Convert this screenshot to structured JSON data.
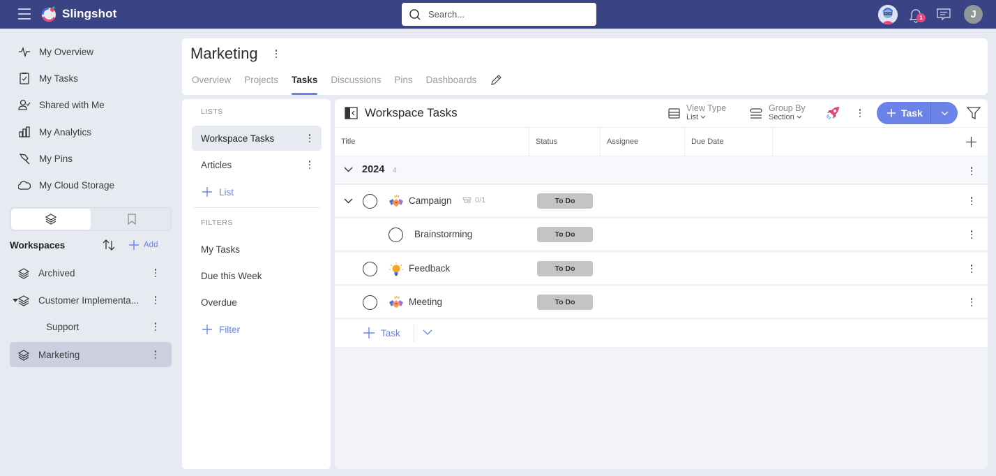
{
  "app": {
    "name": "Slingshot"
  },
  "search": {
    "placeholder": "Search..."
  },
  "topbar": {
    "notification_count": "1",
    "user_initial": "J"
  },
  "nav": {
    "items": [
      {
        "label": "My Overview",
        "icon": "activity-icon"
      },
      {
        "label": "My Tasks",
        "icon": "clipboard-check-icon"
      },
      {
        "label": "Shared with Me",
        "icon": "user-check-icon"
      },
      {
        "label": "My Analytics",
        "icon": "bar-chart-icon"
      },
      {
        "label": "My Pins",
        "icon": "pin-icon"
      },
      {
        "label": "My Cloud Storage",
        "icon": "cloud-icon"
      }
    ],
    "workspaces_label": "Workspaces",
    "add_label": "Add",
    "workspaces": [
      {
        "label": "Archived"
      },
      {
        "label": "Customer Implementa..."
      },
      {
        "label": "Support"
      },
      {
        "label": "Marketing",
        "selected": true
      }
    ]
  },
  "header": {
    "title": "Marketing",
    "tabs": [
      "Overview",
      "Projects",
      "Tasks",
      "Discussions",
      "Pins",
      "Dashboards"
    ],
    "active_tab": "Tasks"
  },
  "lists": {
    "lists_label": "LISTS",
    "items": [
      "Workspace Tasks",
      "Articles"
    ],
    "add_list_label": "List",
    "filters_label": "FILTERS",
    "filters": [
      "My Tasks",
      "Due this Week",
      "Overdue"
    ],
    "add_filter_label": "Filter"
  },
  "tasks": {
    "title": "Workspace Tasks",
    "view_type_label": "View Type",
    "view_type_value": "List",
    "group_by_label": "Group By",
    "group_by_value": "Section",
    "new_task_label": "Task",
    "columns": [
      "Title",
      "Status",
      "Assignee",
      "Due Date"
    ],
    "group": {
      "name": "2024",
      "count": "4"
    },
    "rows": [
      {
        "title": "Campaign",
        "status": "To Do",
        "subtasks": "0/1",
        "emoji": "handshake",
        "expanded": true
      },
      {
        "title": "Brainstorming",
        "status": "To Do",
        "subtask": true
      },
      {
        "title": "Feedback",
        "status": "To Do",
        "emoji": "lightbulb"
      },
      {
        "title": "Meeting",
        "status": "To Do",
        "emoji": "handshake"
      }
    ],
    "add_task_label": "Task"
  },
  "colors": {
    "topbar": "#3a4383",
    "accent": "#6b83e8",
    "status_todo": "#c4c4c4",
    "badge": "#e8457a"
  }
}
